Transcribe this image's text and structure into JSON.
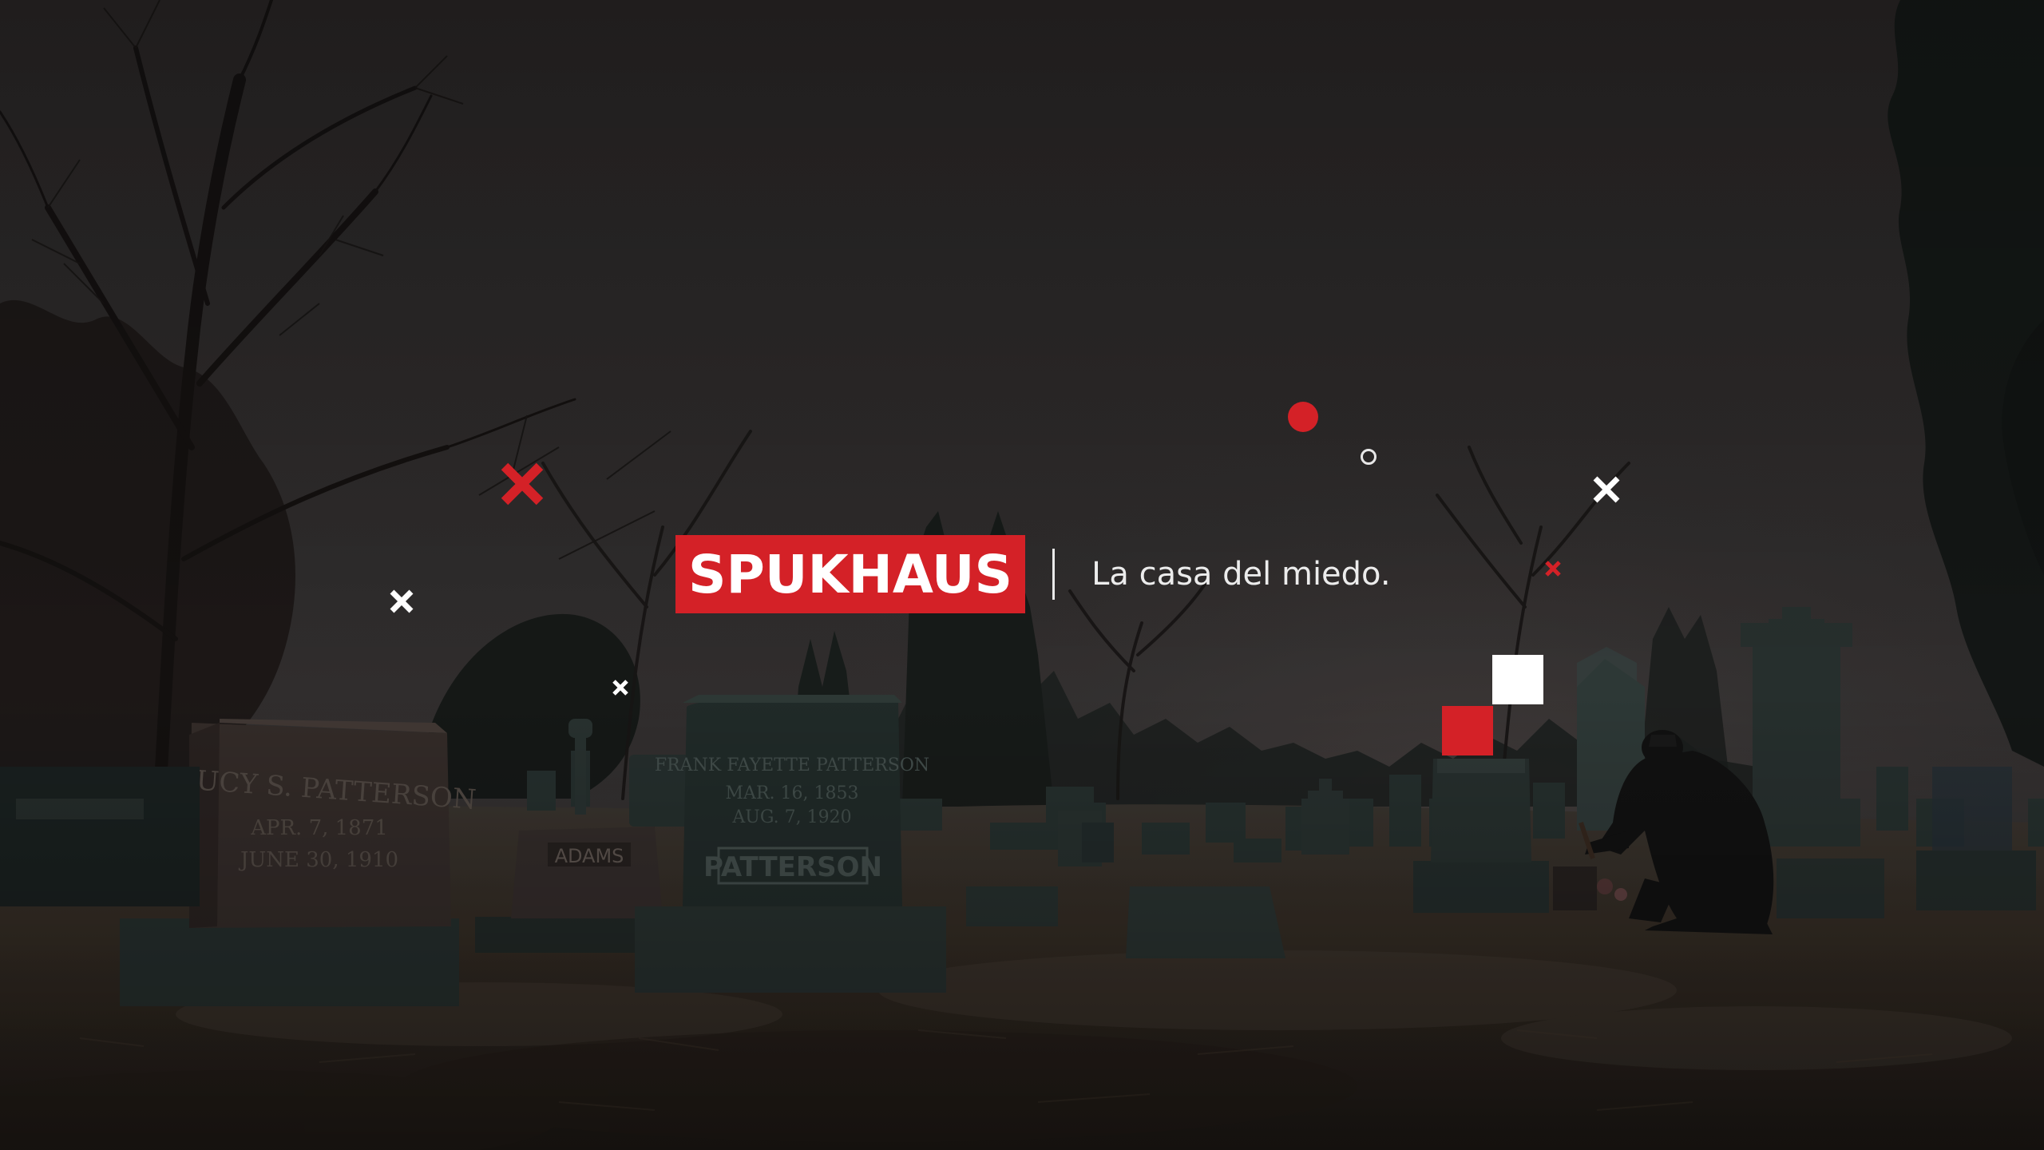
{
  "brand": {
    "name": "SPUKHAUS",
    "tagline": "La casa del miedo."
  },
  "headstone_inscriptions": {
    "lucy": [
      "LUCY S. PATTERSON",
      "APR. 7, 1871",
      "JUNE 30, 1910"
    ],
    "adams": "ADAMS",
    "patterson": [
      "FRANK FAYETTE PATTERSON",
      "MAR. 16, 1853",
      "AUG. 7, 1920",
      "PATTERSON"
    ]
  },
  "colors": {
    "accent": "#d42127",
    "white": "#ffffff",
    "sky": "#3a3434",
    "ground": "#3a3026"
  }
}
